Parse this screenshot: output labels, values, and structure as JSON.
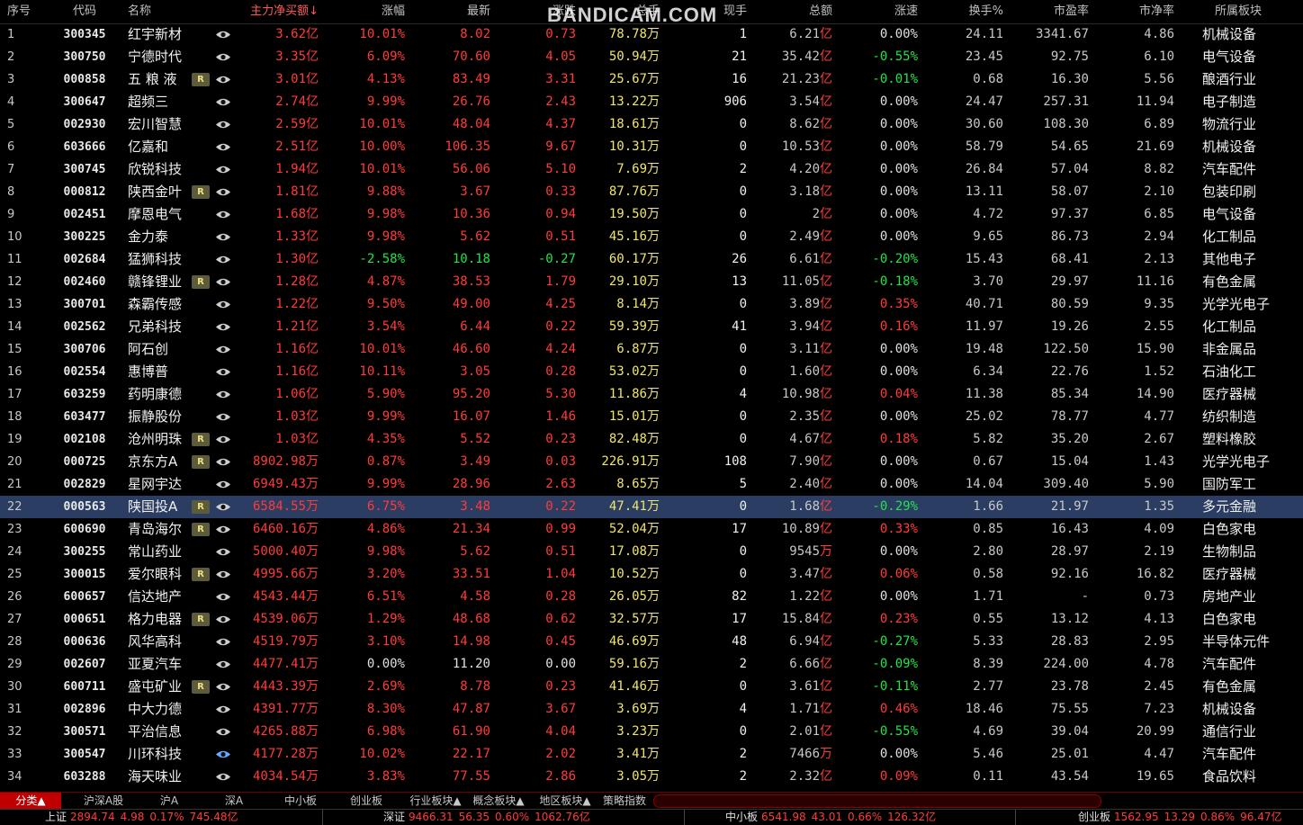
{
  "header": [
    "序号",
    "代码",
    "名称",
    "主力净买额↓",
    "涨幅",
    "最新",
    "涨跌",
    "总手",
    "现手",
    "总额",
    "涨速",
    "换手%",
    "市盈率",
    "市净率",
    "所属板块"
  ],
  "watermark": "BANDICAM.COM",
  "rows": [
    {
      "seq": "1",
      "code": "300345",
      "name": "红宇新材",
      "badge": "",
      "net": "3.62",
      "netu": "亿",
      "pct": "10.01%",
      "last": "8.02",
      "chg": "0.73",
      "vol": "78.78",
      "volu": "万",
      "cur": "1",
      "amt": "6.21",
      "amtu": "亿",
      "spd": "0.00%",
      "turn": "24.11",
      "pe": "3341.67",
      "pb": "4.86",
      "sec": "机械设备"
    },
    {
      "seq": "2",
      "code": "300750",
      "name": "宁德时代",
      "badge": "",
      "net": "3.35",
      "netu": "亿",
      "pct": "6.09%",
      "last": "70.60",
      "chg": "4.05",
      "vol": "50.94",
      "volu": "万",
      "cur": "21",
      "amt": "35.42",
      "amtu": "亿",
      "spd": "-0.55%",
      "turn": "23.45",
      "pe": "92.75",
      "pb": "6.10",
      "sec": "电气设备"
    },
    {
      "seq": "3",
      "code": "000858",
      "name": "五 粮 液",
      "badge": "R",
      "net": "3.01",
      "netu": "亿",
      "pct": "4.13%",
      "last": "83.49",
      "chg": "3.31",
      "vol": "25.67",
      "volu": "万",
      "cur": "16",
      "amt": "21.23",
      "amtu": "亿",
      "spd": "-0.01%",
      "turn": "0.68",
      "pe": "16.30",
      "pb": "5.56",
      "sec": "酿酒行业"
    },
    {
      "seq": "4",
      "code": "300647",
      "name": "超频三",
      "badge": "",
      "net": "2.74",
      "netu": "亿",
      "pct": "9.99%",
      "last": "26.76",
      "chg": "2.43",
      "vol": "13.22",
      "volu": "万",
      "cur": "906",
      "amt": "3.54",
      "amtu": "亿",
      "spd": "0.00%",
      "turn": "24.47",
      "pe": "257.31",
      "pb": "11.94",
      "sec": "电子制造"
    },
    {
      "seq": "5",
      "code": "002930",
      "name": "宏川智慧",
      "badge": "",
      "net": "2.59",
      "netu": "亿",
      "pct": "10.01%",
      "last": "48.04",
      "chg": "4.37",
      "vol": "18.61",
      "volu": "万",
      "cur": "0",
      "amt": "8.62",
      "amtu": "亿",
      "spd": "0.00%",
      "turn": "30.60",
      "pe": "108.30",
      "pb": "6.89",
      "sec": "物流行业"
    },
    {
      "seq": "6",
      "code": "603666",
      "name": "亿嘉和",
      "badge": "",
      "net": "2.51",
      "netu": "亿",
      "pct": "10.00%",
      "last": "106.35",
      "chg": "9.67",
      "vol": "10.31",
      "volu": "万",
      "cur": "0",
      "amt": "10.53",
      "amtu": "亿",
      "spd": "0.00%",
      "turn": "58.79",
      "pe": "54.65",
      "pb": "21.69",
      "sec": "机械设备"
    },
    {
      "seq": "7",
      "code": "300745",
      "name": "欣锐科技",
      "badge": "",
      "net": "1.94",
      "netu": "亿",
      "pct": "10.01%",
      "last": "56.06",
      "chg": "5.10",
      "vol": "7.69",
      "volu": "万",
      "cur": "2",
      "amt": "4.20",
      "amtu": "亿",
      "spd": "0.00%",
      "turn": "26.84",
      "pe": "57.04",
      "pb": "8.82",
      "sec": "汽车配件"
    },
    {
      "seq": "8",
      "code": "000812",
      "name": "陕西金叶",
      "badge": "R",
      "net": "1.81",
      "netu": "亿",
      "pct": "9.88%",
      "last": "3.67",
      "chg": "0.33",
      "vol": "87.76",
      "volu": "万",
      "cur": "0",
      "amt": "3.18",
      "amtu": "亿",
      "spd": "0.00%",
      "turn": "13.11",
      "pe": "58.07",
      "pb": "2.10",
      "sec": "包装印刷"
    },
    {
      "seq": "9",
      "code": "002451",
      "name": "摩恩电气",
      "badge": "",
      "net": "1.68",
      "netu": "亿",
      "pct": "9.98%",
      "last": "10.36",
      "chg": "0.94",
      "vol": "19.50",
      "volu": "万",
      "cur": "0",
      "amt": "2",
      "amtu": "亿",
      "spd": "0.00%",
      "turn": "4.72",
      "pe": "97.37",
      "pb": "6.85",
      "sec": "电气设备"
    },
    {
      "seq": "10",
      "code": "300225",
      "name": "金力泰",
      "badge": "",
      "net": "1.33",
      "netu": "亿",
      "pct": "9.98%",
      "last": "5.62",
      "chg": "0.51",
      "vol": "45.16",
      "volu": "万",
      "cur": "0",
      "amt": "2.49",
      "amtu": "亿",
      "spd": "0.00%",
      "turn": "9.65",
      "pe": "86.73",
      "pb": "2.94",
      "sec": "化工制品"
    },
    {
      "seq": "11",
      "code": "002684",
      "name": "猛狮科技",
      "badge": "",
      "net": "1.30",
      "netu": "亿",
      "pct": "-2.58%",
      "last": "10.18",
      "chg": "-0.27",
      "vol": "60.17",
      "volu": "万",
      "cur": "26",
      "amt": "6.61",
      "amtu": "亿",
      "spd": "-0.20%",
      "turn": "15.43",
      "pe": "68.41",
      "pb": "2.13",
      "sec": "其他电子"
    },
    {
      "seq": "12",
      "code": "002460",
      "name": "赣锋锂业",
      "badge": "R",
      "net": "1.28",
      "netu": "亿",
      "pct": "4.87%",
      "last": "38.53",
      "chg": "1.79",
      "vol": "29.10",
      "volu": "万",
      "cur": "13",
      "amt": "11.05",
      "amtu": "亿",
      "spd": "-0.18%",
      "turn": "3.70",
      "pe": "29.97",
      "pb": "11.16",
      "sec": "有色金属"
    },
    {
      "seq": "13",
      "code": "300701",
      "name": "森霸传感",
      "badge": "",
      "net": "1.22",
      "netu": "亿",
      "pct": "9.50%",
      "last": "49.00",
      "chg": "4.25",
      "vol": "8.14",
      "volu": "万",
      "cur": "0",
      "amt": "3.89",
      "amtu": "亿",
      "spd": "0.35%",
      "turn": "40.71",
      "pe": "80.59",
      "pb": "9.35",
      "sec": "光学光电子"
    },
    {
      "seq": "14",
      "code": "002562",
      "name": "兄弟科技",
      "badge": "",
      "net": "1.21",
      "netu": "亿",
      "pct": "3.54%",
      "last": "6.44",
      "chg": "0.22",
      "vol": "59.39",
      "volu": "万",
      "cur": "41",
      "amt": "3.94",
      "amtu": "亿",
      "spd": "0.16%",
      "turn": "11.97",
      "pe": "19.26",
      "pb": "2.55",
      "sec": "化工制品"
    },
    {
      "seq": "15",
      "code": "300706",
      "name": "阿石创",
      "badge": "",
      "net": "1.16",
      "netu": "亿",
      "pct": "10.01%",
      "last": "46.60",
      "chg": "4.24",
      "vol": "6.87",
      "volu": "万",
      "cur": "0",
      "amt": "3.11",
      "amtu": "亿",
      "spd": "0.00%",
      "turn": "19.48",
      "pe": "122.50",
      "pb": "15.90",
      "sec": "非金属品"
    },
    {
      "seq": "16",
      "code": "002554",
      "name": "惠博普",
      "badge": "",
      "net": "1.16",
      "netu": "亿",
      "pct": "10.11%",
      "last": "3.05",
      "chg": "0.28",
      "vol": "53.02",
      "volu": "万",
      "cur": "0",
      "amt": "1.60",
      "amtu": "亿",
      "spd": "0.00%",
      "turn": "6.34",
      "pe": "22.76",
      "pb": "1.52",
      "sec": "石油化工"
    },
    {
      "seq": "17",
      "code": "603259",
      "name": "药明康德",
      "badge": "",
      "net": "1.06",
      "netu": "亿",
      "pct": "5.90%",
      "last": "95.20",
      "chg": "5.30",
      "vol": "11.86",
      "volu": "万",
      "cur": "4",
      "amt": "10.98",
      "amtu": "亿",
      "spd": "0.04%",
      "turn": "11.38",
      "pe": "85.34",
      "pb": "14.90",
      "sec": "医疗器械"
    },
    {
      "seq": "18",
      "code": "603477",
      "name": "振静股份",
      "badge": "",
      "net": "1.03",
      "netu": "亿",
      "pct": "9.99%",
      "last": "16.07",
      "chg": "1.46",
      "vol": "15.01",
      "volu": "万",
      "cur": "0",
      "amt": "2.35",
      "amtu": "亿",
      "spd": "0.00%",
      "turn": "25.02",
      "pe": "78.77",
      "pb": "4.77",
      "sec": "纺织制造"
    },
    {
      "seq": "19",
      "code": "002108",
      "name": "沧州明珠",
      "badge": "R",
      "net": "1.03",
      "netu": "亿",
      "pct": "4.35%",
      "last": "5.52",
      "chg": "0.23",
      "vol": "82.48",
      "volu": "万",
      "cur": "0",
      "amt": "4.67",
      "amtu": "亿",
      "spd": "0.18%",
      "turn": "5.82",
      "pe": "35.20",
      "pb": "2.67",
      "sec": "塑料橡胶"
    },
    {
      "seq": "20",
      "code": "000725",
      "name": "京东方A",
      "badge": "R",
      "net": "8902.98",
      "netu": "万",
      "pct": "0.87%",
      "last": "3.49",
      "chg": "0.03",
      "vol": "226.91",
      "volu": "万",
      "cur": "108",
      "amt": "7.90",
      "amtu": "亿",
      "spd": "0.00%",
      "turn": "0.67",
      "pe": "15.04",
      "pb": "1.43",
      "sec": "光学光电子"
    },
    {
      "seq": "21",
      "code": "002829",
      "name": "星网宇达",
      "badge": "",
      "net": "6949.43",
      "netu": "万",
      "pct": "9.99%",
      "last": "28.96",
      "chg": "2.63",
      "vol": "8.65",
      "volu": "万",
      "cur": "5",
      "amt": "2.40",
      "amtu": "亿",
      "spd": "0.00%",
      "turn": "14.04",
      "pe": "309.40",
      "pb": "5.90",
      "sec": "国防军工"
    },
    {
      "seq": "22",
      "code": "000563",
      "name": "陕国投A",
      "badge": "R",
      "net": "6584.55",
      "netu": "万",
      "pct": "6.75%",
      "last": "3.48",
      "chg": "0.22",
      "vol": "47.41",
      "volu": "万",
      "cur": "0",
      "amt": "1.68",
      "amtu": "亿",
      "spd": "-0.29%",
      "turn": "1.66",
      "pe": "21.97",
      "pb": "1.35",
      "sec": "多元金融",
      "selected": true
    },
    {
      "seq": "23",
      "code": "600690",
      "name": "青岛海尔",
      "badge": "R",
      "net": "6460.16",
      "netu": "万",
      "pct": "4.86%",
      "last": "21.34",
      "chg": "0.99",
      "vol": "52.04",
      "volu": "万",
      "cur": "17",
      "amt": "10.89",
      "amtu": "亿",
      "spd": "0.33%",
      "turn": "0.85",
      "pe": "16.43",
      "pb": "4.09",
      "sec": "白色家电"
    },
    {
      "seq": "24",
      "code": "300255",
      "name": "常山药业",
      "badge": "",
      "net": "5000.40",
      "netu": "万",
      "pct": "9.98%",
      "last": "5.62",
      "chg": "0.51",
      "vol": "17.08",
      "volu": "万",
      "cur": "0",
      "amt": "9545",
      "amtu": "万",
      "spd": "0.00%",
      "turn": "2.80",
      "pe": "28.97",
      "pb": "2.19",
      "sec": "生物制品"
    },
    {
      "seq": "25",
      "code": "300015",
      "name": "爱尔眼科",
      "badge": "R",
      "net": "4995.66",
      "netu": "万",
      "pct": "3.20%",
      "last": "33.51",
      "chg": "1.04",
      "vol": "10.52",
      "volu": "万",
      "cur": "0",
      "amt": "3.47",
      "amtu": "亿",
      "spd": "0.06%",
      "turn": "0.58",
      "pe": "92.16",
      "pb": "16.82",
      "sec": "医疗器械"
    },
    {
      "seq": "26",
      "code": "600657",
      "name": "信达地产",
      "badge": "",
      "net": "4543.44",
      "netu": "万",
      "pct": "6.51%",
      "last": "4.58",
      "chg": "0.28",
      "vol": "26.05",
      "volu": "万",
      "cur": "82",
      "amt": "1.22",
      "amtu": "亿",
      "spd": "0.00%",
      "turn": "1.71",
      "pe": "-",
      "pb": "0.73",
      "sec": "房地产业"
    },
    {
      "seq": "27",
      "code": "000651",
      "name": "格力电器",
      "badge": "R",
      "net": "4539.06",
      "netu": "万",
      "pct": "1.29%",
      "last": "48.68",
      "chg": "0.62",
      "vol": "32.57",
      "volu": "万",
      "cur": "17",
      "amt": "15.84",
      "amtu": "亿",
      "spd": "0.23%",
      "turn": "0.55",
      "pe": "13.12",
      "pb": "4.13",
      "sec": "白色家电"
    },
    {
      "seq": "28",
      "code": "000636",
      "name": "风华高科",
      "badge": "",
      "net": "4519.79",
      "netu": "万",
      "pct": "3.10%",
      "last": "14.98",
      "chg": "0.45",
      "vol": "46.69",
      "volu": "万",
      "cur": "48",
      "amt": "6.94",
      "amtu": "亿",
      "spd": "-0.27%",
      "turn": "5.33",
      "pe": "28.83",
      "pb": "2.95",
      "sec": "半导体元件"
    },
    {
      "seq": "29",
      "code": "002607",
      "name": "亚夏汽车",
      "badge": "",
      "net": "4477.41",
      "netu": "万",
      "pct": "0.00%",
      "last": "11.20",
      "chg": "0.00",
      "vol": "59.16",
      "volu": "万",
      "cur": "2",
      "amt": "6.66",
      "amtu": "亿",
      "spd": "-0.09%",
      "turn": "8.39",
      "pe": "224.00",
      "pb": "4.78",
      "sec": "汽车配件"
    },
    {
      "seq": "30",
      "code": "600711",
      "name": "盛屯矿业",
      "badge": "R",
      "net": "4443.39",
      "netu": "万",
      "pct": "2.69%",
      "last": "8.78",
      "chg": "0.23",
      "vol": "41.46",
      "volu": "万",
      "cur": "0",
      "amt": "3.61",
      "amtu": "亿",
      "spd": "-0.11%",
      "turn": "2.77",
      "pe": "23.78",
      "pb": "2.45",
      "sec": "有色金属"
    },
    {
      "seq": "31",
      "code": "002896",
      "name": "中大力德",
      "badge": "",
      "net": "4391.77",
      "netu": "万",
      "pct": "8.30%",
      "last": "47.87",
      "chg": "3.67",
      "vol": "3.69",
      "volu": "万",
      "cur": "4",
      "amt": "1.71",
      "amtu": "亿",
      "spd": "0.46%",
      "turn": "18.46",
      "pe": "75.55",
      "pb": "7.23",
      "sec": "机械设备"
    },
    {
      "seq": "32",
      "code": "300571",
      "name": "平治信息",
      "badge": "",
      "net": "4265.88",
      "netu": "万",
      "pct": "6.98%",
      "last": "61.90",
      "chg": "4.04",
      "vol": "3.23",
      "volu": "万",
      "cur": "0",
      "amt": "2.01",
      "amtu": "亿",
      "spd": "-0.55%",
      "turn": "4.69",
      "pe": "39.04",
      "pb": "20.99",
      "sec": "通信行业"
    },
    {
      "seq": "33",
      "code": "300547",
      "name": "川环科技",
      "badge": "",
      "net": "4177.28",
      "netu": "万",
      "pct": "10.02%",
      "last": "22.17",
      "chg": "2.02",
      "vol": "3.41",
      "volu": "万",
      "cur": "2",
      "amt": "7466",
      "amtu": "万",
      "spd": "0.00%",
      "turn": "5.46",
      "pe": "25.01",
      "pb": "4.47",
      "sec": "汽车配件",
      "eye_active": true
    },
    {
      "seq": "34",
      "code": "603288",
      "name": "海天味业",
      "badge": "",
      "net": "4034.54",
      "netu": "万",
      "pct": "3.83%",
      "last": "77.55",
      "chg": "2.86",
      "vol": "3.05",
      "volu": "万",
      "cur": "2",
      "amt": "2.32",
      "amtu": "亿",
      "spd": "0.09%",
      "turn": "0.11",
      "pe": "43.54",
      "pb": "19.65",
      "sec": "食品饮料"
    }
  ],
  "tabs": [
    "分类▲",
    "沪深A股",
    "沪A",
    "深A",
    "中小板",
    "创业板",
    "行业板块▲",
    "概念板块▲",
    "地区板块▲",
    "策略指数"
  ],
  "status": [
    {
      "label": "上证",
      "values": [
        "2894.74",
        "4.98",
        "0.17%",
        "745.48亿"
      ]
    },
    {
      "label": "深证",
      "values": [
        "9466.31",
        "56.35",
        "0.60%",
        "1062.76亿"
      ]
    },
    {
      "label": "中小板",
      "values": [
        "6541.98",
        "43.01",
        "0.66%",
        "126.32亿"
      ]
    },
    {
      "label": "创业板",
      "values": [
        "1562.95",
        "13.29",
        "0.86%",
        "96.47亿"
      ]
    }
  ],
  "colors": {
    "up": "#ff3b3b",
    "down": "#22e34a",
    "volume": "#f0e66a",
    "selected_row": "#2b3d63",
    "tab_active": "#c00000"
  }
}
